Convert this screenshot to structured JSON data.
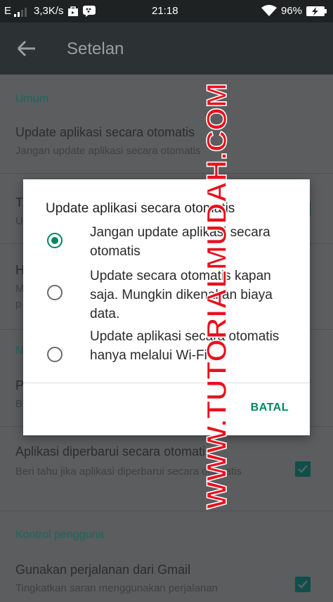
{
  "status_bar": {
    "network": "E",
    "speed": "3,3K/s",
    "time": "21:18",
    "battery": "96%",
    "icons": [
      "signal-icon",
      "shopping-bag-icon",
      "bbm-icon",
      "wifi-icon",
      "battery-charging-icon"
    ]
  },
  "app_bar": {
    "title": "Setelan",
    "back_icon": "arrow-left-icon"
  },
  "settings": {
    "section_umum": "Umum",
    "auto_update_title": "Update aplikasi secara otomatis",
    "auto_update_sub": "Jangan update aplikasi secara otomatis",
    "row2_title_visible": "T",
    "row2_sub_visible": "U",
    "row3_title_visible": "H",
    "row3_sub_visible": "M",
    "row3_sub2_visible": "p",
    "section_n_visible": "N",
    "row4_title_visible": "P",
    "row4_sub_visible": "B",
    "updated_title": "Aplikasi diperbarui secara otomatis",
    "updated_sub": "Beri tahu jika aplikasi diperbarui secara otomatis",
    "section_kontrol": "Kontrol pengguna",
    "gmail_title": "Gunakan perjalanan dari Gmail",
    "gmail_sub": "Tingkatkan saran menggunakan perjalanan"
  },
  "dialog": {
    "title": "Update aplikasi secara otomatis",
    "options": [
      {
        "label": "Jangan update aplikasi secara otomatis",
        "selected": true
      },
      {
        "label": "Update secara otomatis kapan saja. Mungkin dikenakan biaya data.",
        "selected": false
      },
      {
        "label": "Update aplikasi secara otomatis hanya melalui Wi-Fi",
        "selected": false
      }
    ],
    "cancel_label": "BATAL"
  },
  "watermark": {
    "text": "WWW.TUTORIALMUDAH.COM",
    "color": "#e8101e"
  },
  "colors": {
    "accent": "#01875f",
    "dim_background": "#5b5d5e",
    "app_bar": "#2c3234"
  }
}
